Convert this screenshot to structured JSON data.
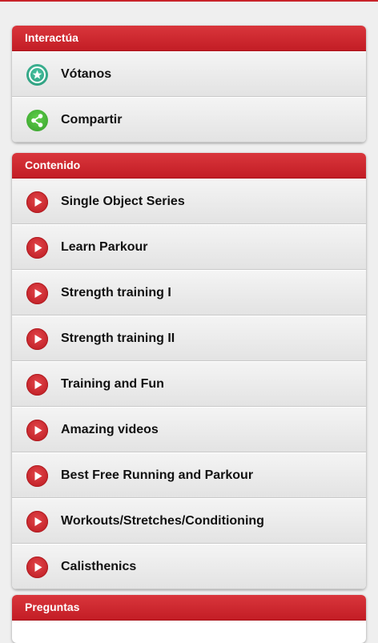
{
  "sections": {
    "interact": {
      "title": "Interactúa",
      "items": [
        {
          "label": "Vótanos",
          "icon": "star-icon"
        },
        {
          "label": "Compartir",
          "icon": "share-icon"
        }
      ]
    },
    "content": {
      "title": "Contenido",
      "items": [
        {
          "label": "Single Object Series",
          "icon": "play-icon"
        },
        {
          "label": "Learn Parkour",
          "icon": "play-icon"
        },
        {
          "label": "Strength training I",
          "icon": "play-icon"
        },
        {
          "label": "Strength training II",
          "icon": "play-icon"
        },
        {
          "label": "Training and Fun",
          "icon": "play-icon"
        },
        {
          "label": "Amazing videos",
          "icon": "play-icon"
        },
        {
          "label": "Best Free Running and Parkour",
          "icon": "play-icon"
        },
        {
          "label": "Workouts/Stretches/Conditioning",
          "icon": "play-icon"
        },
        {
          "label": "Calisthenics",
          "icon": "play-icon"
        }
      ]
    },
    "faq": {
      "title": "Preguntas"
    }
  },
  "colors": {
    "accent": "#c8232a",
    "header_text": "#ffffff",
    "item_text": "#111111",
    "star_icon": "#2f9f80",
    "share_icon": "#3fa832"
  }
}
